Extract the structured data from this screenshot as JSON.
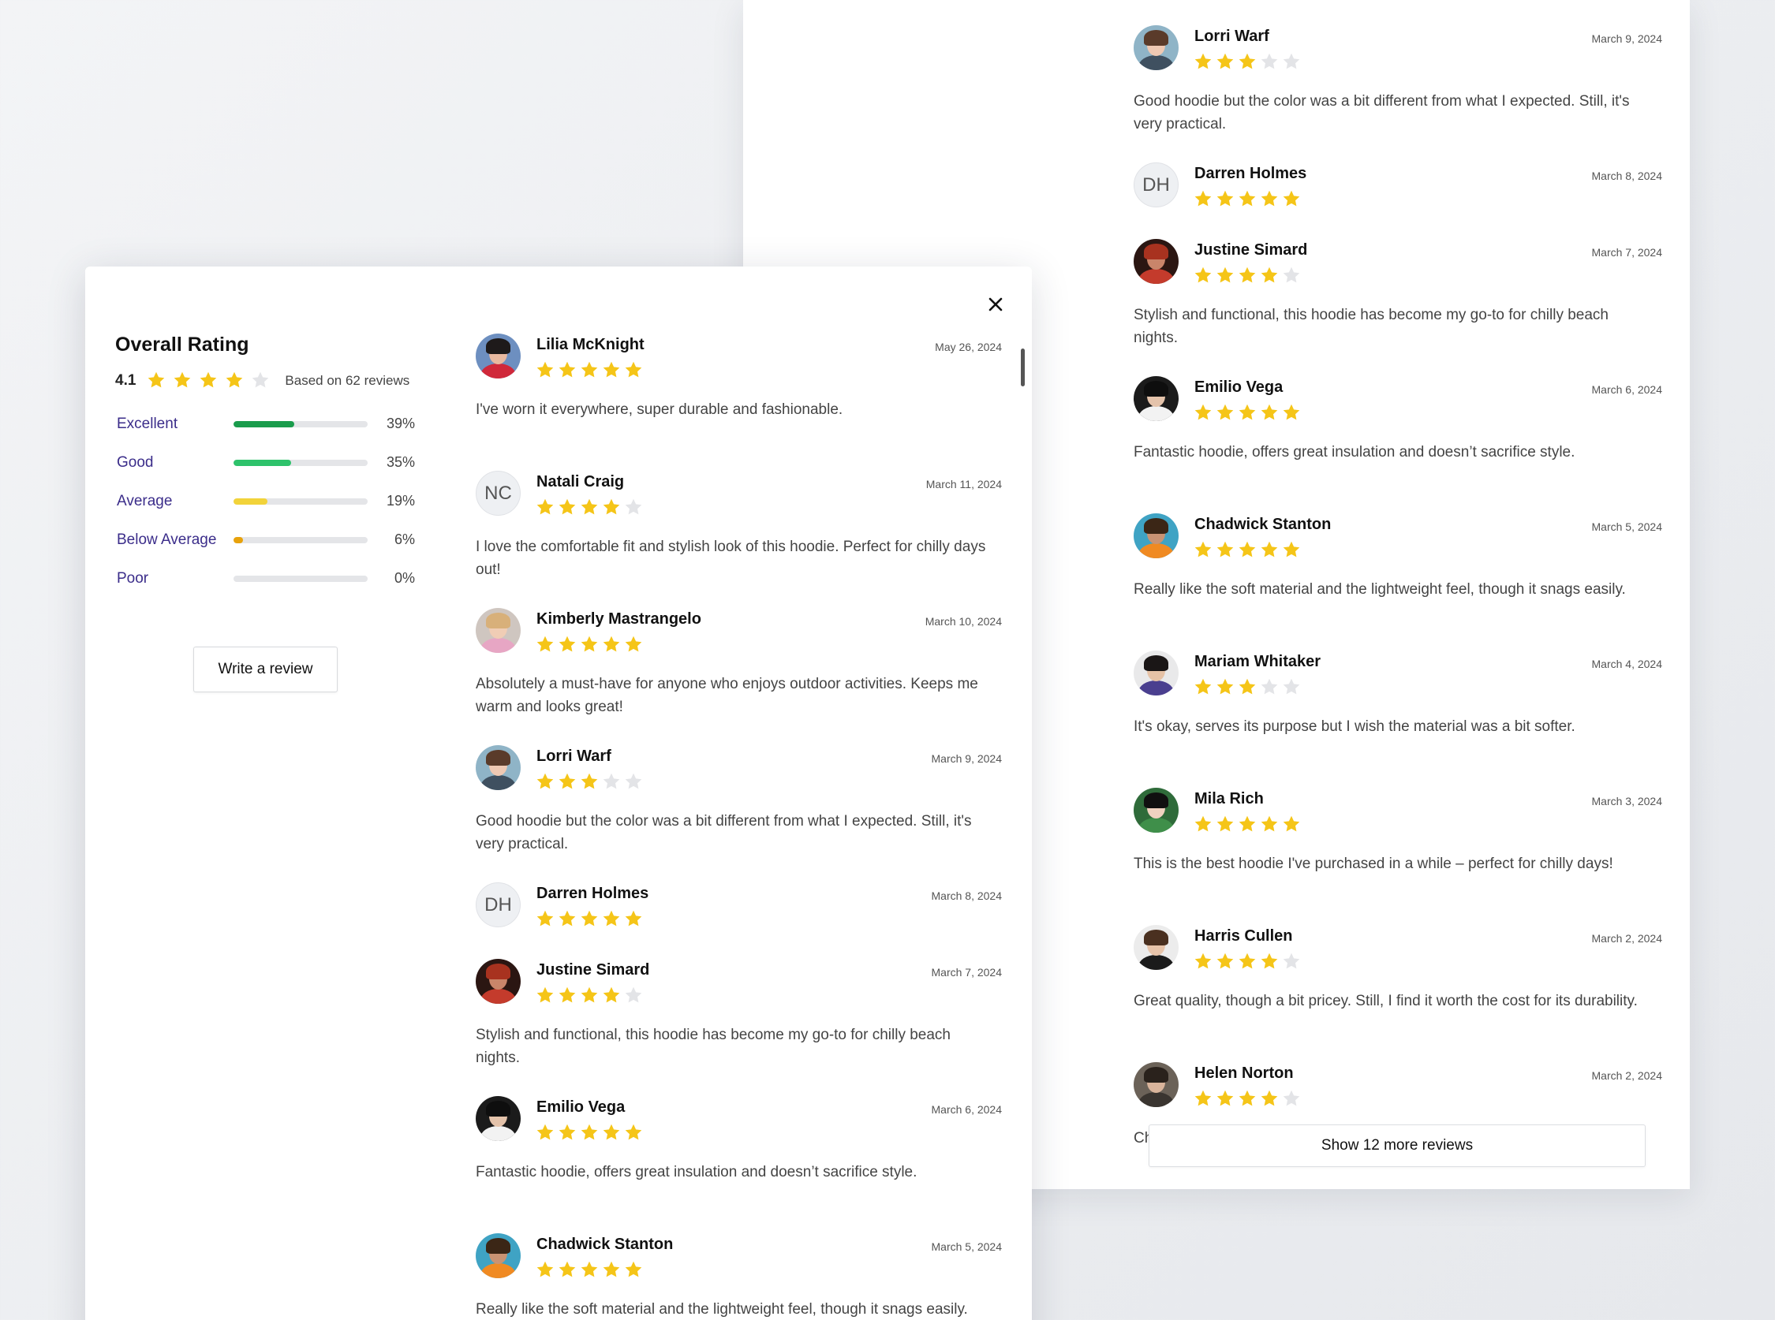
{
  "colors": {
    "star": "#f5c518",
    "star_empty": "#e3e4e7",
    "bar_excellent": "#1a9c4c",
    "bar_good": "#2ec26b",
    "bar_average": "#f2d33a",
    "bar_below": "#e8a20b",
    "label": "#3b2d8a"
  },
  "summary": {
    "title": "Overall Rating",
    "average": "4.1",
    "average_stars": 4,
    "based_on": "Based on 62 reviews",
    "distribution": [
      {
        "label": "Excellent",
        "percent_text": "39%",
        "fraction": 0.45,
        "color": "#1a9c4c"
      },
      {
        "label": "Good",
        "percent_text": "35%",
        "fraction": 0.43,
        "color": "#2ec26b"
      },
      {
        "label": "Average",
        "percent_text": "19%",
        "fraction": 0.25,
        "color": "#f2d33a"
      },
      {
        "label": "Below Average",
        "percent_text": "6%",
        "fraction": 0.07,
        "color": "#e8a20b"
      },
      {
        "label": "Poor",
        "percent_text": "0%",
        "fraction": 0,
        "color": "#e8a20b"
      }
    ],
    "write_review_label": "Write a review"
  },
  "front_reviews": [
    {
      "name": "Lilia McKnight",
      "date": "May 26, 2024",
      "stars": 5,
      "text": "I've worn it everywhere, super durable and fashionable.",
      "avatar": {
        "type": "photo",
        "bg": "#6d8fc0",
        "skin": "#e8b9a0",
        "hair": "#1e1a1a",
        "body": "#d0283a"
      }
    },
    {
      "name": "Natali Craig",
      "date": "March 11, 2024",
      "stars": 4,
      "text": "I love the comfortable fit and stylish look of this hoodie. Perfect for chilly days out!",
      "avatar": {
        "type": "initials",
        "initials": "NC"
      }
    },
    {
      "name": "Kimberly Mastrangelo",
      "date": "March 10, 2024",
      "stars": 5,
      "text": "Absolutely a must-have for anyone who enjoys outdoor activities. Keeps me warm and looks great!",
      "avatar": {
        "type": "photo",
        "bg": "#cfc6c0",
        "skin": "#f0cdb5",
        "hair": "#d8b07a",
        "body": "#e7a6c4"
      }
    },
    {
      "name": "Lorri Warf",
      "date": "March 9, 2024",
      "stars": 3,
      "text": "Good hoodie but the color was a bit different from what I expected. Still, it's very practical.",
      "avatar": {
        "type": "photo",
        "bg": "#8fb4c7",
        "skin": "#efc9b3",
        "hair": "#5a3b2a",
        "body": "#3f5060"
      }
    },
    {
      "name": "Darren Holmes",
      "date": "March 8, 2024",
      "stars": 5,
      "text": "",
      "avatar": {
        "type": "initials",
        "initials": "DH"
      }
    },
    {
      "name": "Justine Simard",
      "date": "March 7, 2024",
      "stars": 4,
      "text": "Stylish and functional, this hoodie has become my go-to for chilly beach nights.",
      "avatar": {
        "type": "photo",
        "bg": "#2b1612",
        "skin": "#c9856a",
        "hair": "#a8321f",
        "body": "#c43b2c"
      }
    },
    {
      "name": "Emilio Vega",
      "date": "March 6, 2024",
      "stars": 5,
      "text": "Fantastic hoodie, offers great insulation and doesn’t sacrifice style.",
      "avatar": {
        "type": "photo",
        "bg": "#1b1b1b",
        "skin": "#e4c3ab",
        "hair": "#0e0e0e",
        "body": "#f2f2f2"
      }
    },
    {
      "name": "Chadwick Stanton",
      "date": "March 5, 2024",
      "stars": 5,
      "text": "Really like the soft material and the lightweight feel, though it snags easily.",
      "avatar": {
        "type": "photo",
        "bg": "#3fa3c4",
        "skin": "#c99373",
        "hair": "#3b2616",
        "body": "#f08a22"
      }
    }
  ],
  "back_reviews": [
    {
      "name": "Lorri Warf",
      "date": "March 9, 2024",
      "stars": 3,
      "text": "Good hoodie but the color was a bit different from what I expected. Still, it's very practical.",
      "avatar": {
        "type": "photo",
        "bg": "#8fb4c7",
        "skin": "#efc9b3",
        "hair": "#5a3b2a",
        "body": "#3f5060"
      }
    },
    {
      "name": "Darren Holmes",
      "date": "March 8, 2024",
      "stars": 5,
      "text": "",
      "avatar": {
        "type": "initials",
        "initials": "DH"
      }
    },
    {
      "name": "Justine Simard",
      "date": "March 7, 2024",
      "stars": 4,
      "text": "Stylish and functional, this hoodie has become my go-to for chilly beach nights.",
      "avatar": {
        "type": "photo",
        "bg": "#2b1612",
        "skin": "#c9856a",
        "hair": "#a8321f",
        "body": "#c43b2c"
      }
    },
    {
      "name": "Emilio Vega",
      "date": "March 6, 2024",
      "stars": 5,
      "text": "Fantastic hoodie, offers great insulation and doesn’t sacrifice style.",
      "avatar": {
        "type": "photo",
        "bg": "#1b1b1b",
        "skin": "#e4c3ab",
        "hair": "#0e0e0e",
        "body": "#f2f2f2"
      }
    },
    {
      "name": "Chadwick Stanton",
      "date": "March 5, 2024",
      "stars": 5,
      "text": "Really like the soft material and the lightweight feel, though it snags easily.",
      "avatar": {
        "type": "photo",
        "bg": "#3fa3c4",
        "skin": "#c99373",
        "hair": "#3b2616",
        "body": "#f08a22"
      }
    },
    {
      "name": "Mariam Whitaker",
      "date": "March 4, 2024",
      "stars": 3,
      "text": "It's okay, serves its purpose but I wish the material was a bit softer.",
      "avatar": {
        "type": "photo",
        "bg": "#e9e9ea",
        "skin": "#e6c2a6",
        "hair": "#1a1616",
        "body": "#4a3f8f"
      }
    },
    {
      "name": "Mila Rich",
      "date": "March 3, 2024",
      "stars": 5,
      "text": "This is the best hoodie I've purchased in a while – perfect for chilly days!",
      "avatar": {
        "type": "photo",
        "bg": "#2f6b3a",
        "skin": "#f0d2c0",
        "hair": "#101010",
        "body": "#3f8f4a"
      }
    },
    {
      "name": "Harris Cullen",
      "date": "March 2, 2024",
      "stars": 4,
      "text": "Great quality, though a bit pricey. Still, I find it worth the cost for its durability.",
      "avatar": {
        "type": "photo",
        "bg": "#ececec",
        "skin": "#e7c4aa",
        "hair": "#4a3020",
        "body": "#1b1b1b"
      }
    },
    {
      "name": "Helen Norton",
      "date": "March 2, 2024",
      "stars": 4,
      "text": "Chic and practical, exactly what I needed for my winter wardrobe.",
      "avatar": {
        "type": "photo",
        "bg": "#6b6258",
        "skin": "#d9b49b",
        "hair": "#2a221c",
        "body": "#3a3530"
      }
    }
  ],
  "show_more_label": "Show 12 more reviews",
  "icons": {
    "close": "close-icon",
    "star": "star-icon"
  }
}
